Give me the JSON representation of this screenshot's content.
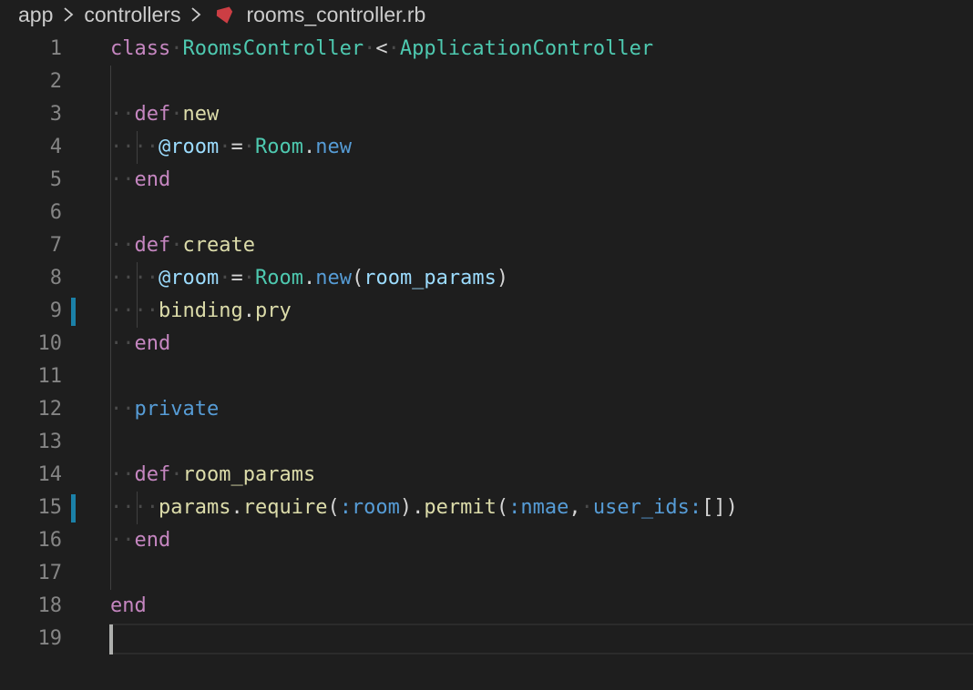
{
  "breadcrumb": {
    "items": [
      "app",
      "controllers",
      "rooms_controller.rb"
    ],
    "file_icon": "ruby-gem-icon",
    "separator_icon": "chevron-right-icon"
  },
  "editor": {
    "gutter_marked_lines": [
      9,
      15
    ],
    "cursor_line": 19,
    "lines": [
      {
        "n": "1",
        "tokens": [
          [
            "kw",
            "class"
          ],
          [
            "ws",
            "·"
          ],
          [
            "cls",
            "RoomsController"
          ],
          [
            "ws",
            "·"
          ],
          [
            "op",
            "<"
          ],
          [
            "ws",
            "·"
          ],
          [
            "cls",
            "ApplicationController"
          ]
        ]
      },
      {
        "n": "2",
        "tokens": []
      },
      {
        "n": "3",
        "tokens": [
          [
            "ws",
            "··"
          ],
          [
            "kw",
            "def"
          ],
          [
            "ws",
            "·"
          ],
          [
            "fn",
            "new"
          ]
        ]
      },
      {
        "n": "4",
        "tokens": [
          [
            "ws",
            "····"
          ],
          [
            "ivar",
            "@room"
          ],
          [
            "ws",
            "·"
          ],
          [
            "op",
            "="
          ],
          [
            "ws",
            "·"
          ],
          [
            "cls",
            "Room"
          ],
          [
            "op",
            "."
          ],
          [
            "mth",
            "new"
          ]
        ]
      },
      {
        "n": "5",
        "tokens": [
          [
            "ws",
            "··"
          ],
          [
            "kw",
            "end"
          ]
        ]
      },
      {
        "n": "6",
        "tokens": []
      },
      {
        "n": "7",
        "tokens": [
          [
            "ws",
            "··"
          ],
          [
            "kw",
            "def"
          ],
          [
            "ws",
            "·"
          ],
          [
            "fn",
            "create"
          ]
        ]
      },
      {
        "n": "8",
        "tokens": [
          [
            "ws",
            "····"
          ],
          [
            "ivar",
            "@room"
          ],
          [
            "ws",
            "·"
          ],
          [
            "op",
            "="
          ],
          [
            "ws",
            "·"
          ],
          [
            "cls",
            "Room"
          ],
          [
            "op",
            "."
          ],
          [
            "mth",
            "new"
          ],
          [
            "op",
            "("
          ],
          [
            "var",
            "room_params"
          ],
          [
            "op",
            ")"
          ]
        ]
      },
      {
        "n": "9",
        "tokens": [
          [
            "ws",
            "····"
          ],
          [
            "fn",
            "binding"
          ],
          [
            "op",
            "."
          ],
          [
            "fn",
            "pry"
          ]
        ]
      },
      {
        "n": "10",
        "tokens": [
          [
            "ws",
            "··"
          ],
          [
            "kw",
            "end"
          ]
        ]
      },
      {
        "n": "11",
        "tokens": []
      },
      {
        "n": "12",
        "tokens": [
          [
            "ws",
            "··"
          ],
          [
            "mth",
            "private"
          ]
        ]
      },
      {
        "n": "13",
        "tokens": []
      },
      {
        "n": "14",
        "tokens": [
          [
            "ws",
            "··"
          ],
          [
            "kw",
            "def"
          ],
          [
            "ws",
            "·"
          ],
          [
            "fn",
            "room_params"
          ]
        ]
      },
      {
        "n": "15",
        "tokens": [
          [
            "ws",
            "····"
          ],
          [
            "fn",
            "params"
          ],
          [
            "op",
            "."
          ],
          [
            "fn",
            "require"
          ],
          [
            "op",
            "("
          ],
          [
            "sym",
            ":room"
          ],
          [
            "op",
            ")."
          ],
          [
            "fn",
            "permit"
          ],
          [
            "op",
            "("
          ],
          [
            "sym",
            ":nmae"
          ],
          [
            "op",
            ","
          ],
          [
            "ws",
            "·"
          ],
          [
            "sym",
            "user_ids:"
          ],
          [
            "op",
            "[])"
          ]
        ]
      },
      {
        "n": "16",
        "tokens": [
          [
            "ws",
            "··"
          ],
          [
            "kw",
            "end"
          ]
        ]
      },
      {
        "n": "17",
        "tokens": []
      },
      {
        "n": "18",
        "tokens": [
          [
            "kw",
            "end"
          ]
        ]
      },
      {
        "n": "19",
        "tokens": []
      }
    ]
  }
}
